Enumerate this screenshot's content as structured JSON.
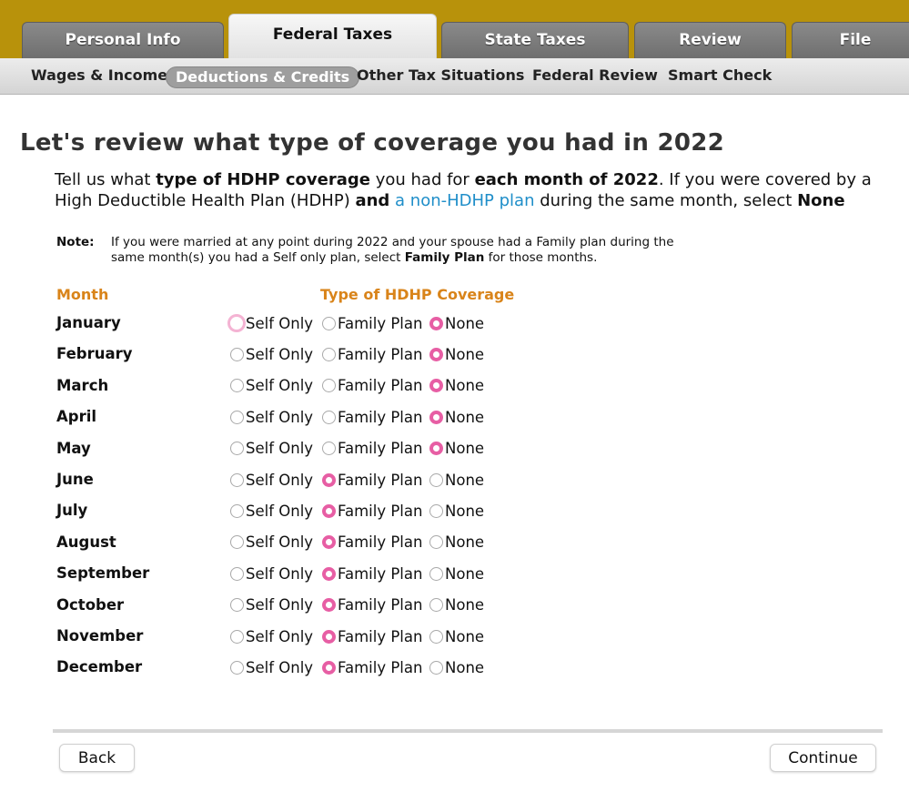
{
  "tabs": [
    {
      "label": "Personal Info"
    },
    {
      "label": "Federal Taxes"
    },
    {
      "label": "State Taxes"
    },
    {
      "label": "Review"
    },
    {
      "label": "File"
    }
  ],
  "subnav": [
    {
      "label": "Wages & Income"
    },
    {
      "label": "Deductions & Credits"
    },
    {
      "label": "Other Tax Situations"
    },
    {
      "label": "Federal Review"
    },
    {
      "label": "Smart Check"
    }
  ],
  "page": {
    "title": "Let's review what type of coverage you had in 2022",
    "intro": {
      "p1": "Tell us what ",
      "b1": "type of HDHP coverage",
      "p2": " you had for ",
      "b2": "each month of 2022",
      "p3": ". If you were covered by a High Deductible Health Plan (HDHP) ",
      "b3": "and",
      "p4": " ",
      "link": "a non-HDHP plan",
      "p5": " during the same month, select ",
      "b4": "None"
    },
    "note": {
      "label": "Note:",
      "t1": "If you were married at any point during 2022 and your spouse had a Family plan during the same month(s) you had a Self only plan, select ",
      "bold": "Family Plan",
      "t2": " for those months."
    }
  },
  "table": {
    "month_header": "Month",
    "type_header": "Type of HDHP Coverage",
    "options": [
      "Self Only",
      "Family Plan",
      "None"
    ],
    "rows": [
      {
        "month": "January",
        "selected": "None"
      },
      {
        "month": "February",
        "selected": "None"
      },
      {
        "month": "March",
        "selected": "None"
      },
      {
        "month": "April",
        "selected": "None"
      },
      {
        "month": "May",
        "selected": "None"
      },
      {
        "month": "June",
        "selected": "Family Plan"
      },
      {
        "month": "July",
        "selected": "Family Plan"
      },
      {
        "month": "August",
        "selected": "Family Plan"
      },
      {
        "month": "September",
        "selected": "Family Plan"
      },
      {
        "month": "October",
        "selected": "Family Plan"
      },
      {
        "month": "November",
        "selected": "Family Plan"
      },
      {
        "month": "December",
        "selected": "Family Plan"
      }
    ]
  },
  "buttons": {
    "back": "Back",
    "continue": "Continue"
  },
  "colors": {
    "accent": "#e75ea4",
    "header_orange": "#d9841a",
    "top_bar": "#b8920b",
    "link": "#1f8ec9"
  }
}
